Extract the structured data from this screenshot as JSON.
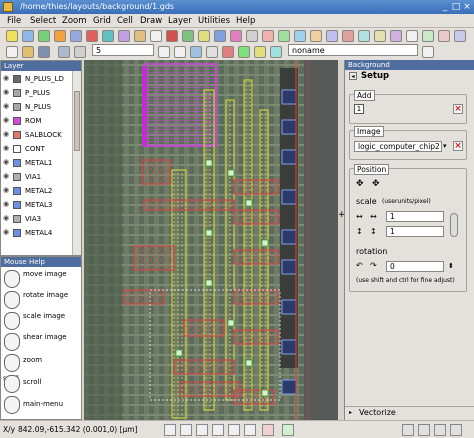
{
  "window": {
    "title": "/home/thies/layouts/background/1.gds"
  },
  "menu": [
    "File",
    "Select",
    "Zoom",
    "Grid",
    "Cell",
    "Draw",
    "Layer",
    "Utilities",
    "Help"
  ],
  "toolbar": {
    "width_value": "5",
    "cell_name": "noname"
  },
  "layers_panel": {
    "title": "Layer",
    "items": [
      {
        "label": "N_PLUS_LD",
        "color": "#6a6a6a"
      },
      {
        "label": "P_PLUS",
        "color": "#a8a8a8"
      },
      {
        "label": "N_PLUS",
        "color": "#a8a8a8"
      },
      {
        "label": "ROM",
        "color": "#d64ad8"
      },
      {
        "label": "SALBLOCK",
        "color": "#e07870"
      },
      {
        "label": "CONT",
        "color": "#ffffff"
      },
      {
        "label": "METAL1",
        "color": "#6f8fe0"
      },
      {
        "label": "VIA1",
        "color": "#b0b0b0"
      },
      {
        "label": "METAL2",
        "color": "#6f8fe0"
      },
      {
        "label": "METAL3",
        "color": "#6f8fe0"
      },
      {
        "label": "VIA3",
        "color": "#b0b0b0"
      },
      {
        "label": "METAL4",
        "color": "#6f8fe0"
      }
    ]
  },
  "mouse_help": {
    "title": "Mouse Help",
    "items": [
      {
        "label": "move image"
      },
      {
        "label": "rotate image"
      },
      {
        "label": "scale image"
      },
      {
        "label": "shear image"
      },
      {
        "label": "zoom"
      },
      {
        "label": "scroll"
      },
      {
        "label": "main-menu"
      }
    ],
    "scroll_caption": "scroll"
  },
  "background_panel": {
    "tab": "Background",
    "setup_title": "Setup",
    "add_label": "Add",
    "image_label": "Image",
    "image_value": "logic_computer_chip2",
    "position_label": "Position",
    "scale_label": "scale",
    "scale_units": "(userunits/pixel)",
    "scale_x": "1",
    "scale_y": "1",
    "rotation_label": "rotation",
    "rotation_value": "0",
    "hint": "(use shift and ctrl for fine adjust)",
    "vectorize_label": "Vectorize"
  },
  "status": {
    "coords": "842.09,-615.342 (0.001,0) [µm]",
    "coord_prefix": "X/y"
  }
}
